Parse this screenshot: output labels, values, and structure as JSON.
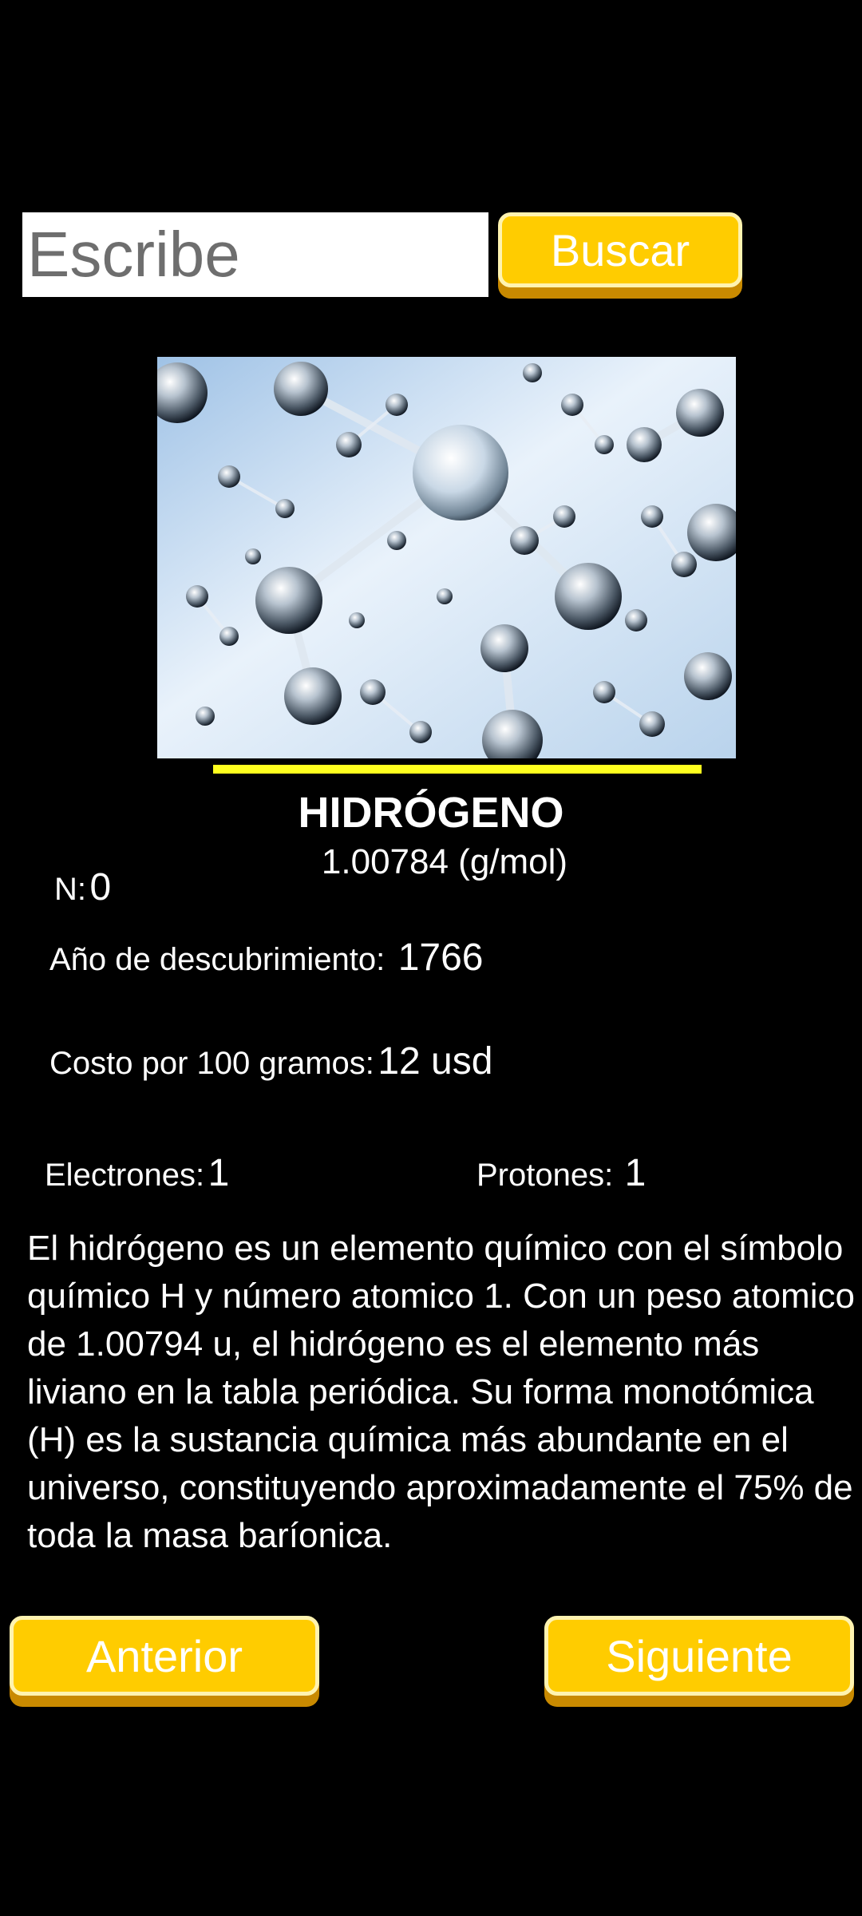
{
  "search": {
    "placeholder": "Escribe",
    "button_label": "Buscar"
  },
  "element": {
    "name": "HIDRÓGENO",
    "mass": "1.00784 (g/mol)",
    "number_label": "N:",
    "number_value": "0",
    "discovery_label": "Año de descubrimiento:",
    "discovery_value": "1766",
    "cost_label": "Costo por 100 gramos:",
    "cost_value": "12 usd",
    "electrons_label": "Electrones:",
    "electrons_value": "1",
    "protons_label": "Protones:",
    "protons_value": "1",
    "description": "El hidrógeno  es un elemento químico  con el símbolo químico H y número atomico 1. Con un peso atomico de 1.00794 u, el hidrógeno es el elemento más liviano en la tabla periódica. Su forma monotómica (H) es la sustancia química más abundante en el universo, constituyendo aproximadamente el 75% de toda la masa baríonica."
  },
  "navigation": {
    "prev_label": "Anterior",
    "next_label": "Siguiente"
  },
  "colors": {
    "background": "#000000",
    "button_fill": "#ffcc00",
    "button_shadow": "#c98a00",
    "divider": "#ffff1e"
  }
}
